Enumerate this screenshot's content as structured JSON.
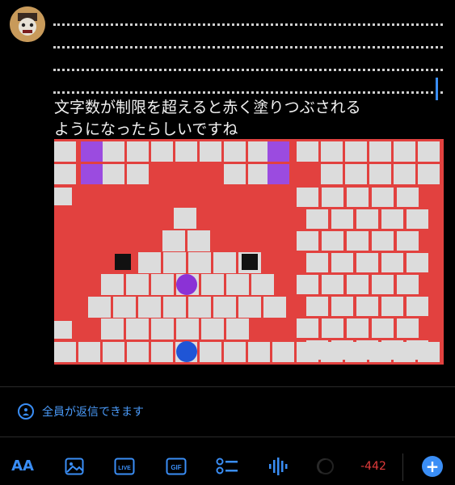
{
  "composer": {
    "caption_line1": "文字数が制限を超えると赤く塗りつぶされる",
    "caption_line2": "ようになったらしいですね"
  },
  "reply_setting": {
    "label": "全員が返信できます",
    "icon": "globe-person-icon"
  },
  "toolbar": {
    "text_size_label": "AA",
    "live_label": "LIVE",
    "gif_label": "GIF",
    "char_counter": "-442",
    "accent_color": "#3a8ef6",
    "counter_color": "#e23b3b"
  },
  "game_colors": {
    "background": "#e2413f",
    "brick": "#dcdcdc",
    "purple_block": "#9b4be0",
    "purple_ball": "#8b32d6",
    "blue_ball": "#1f55d6"
  }
}
